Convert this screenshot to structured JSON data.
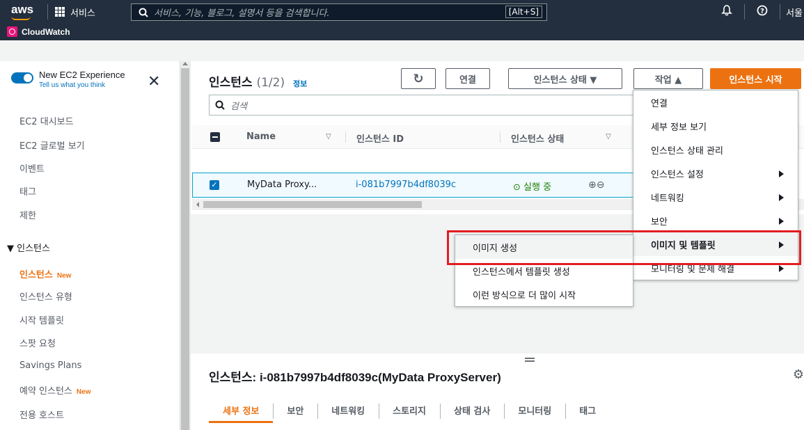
{
  "topnav": {
    "logo": "aws",
    "services_label": "서비스",
    "search_placeholder": "서비스, 기능, 블로그, 설명서 등을 검색합니다.",
    "search_shortcut": "[Alt+S]",
    "region": "서울",
    "favorite_service": "CloudWatch"
  },
  "sidebar": {
    "new_experience_title": "New EC2 Experience",
    "new_experience_sub": "Tell us what you think",
    "items": [
      {
        "label": "EC2 대시보드"
      },
      {
        "label": "EC2 글로벌 보기"
      },
      {
        "label": "이벤트"
      },
      {
        "label": "태그"
      },
      {
        "label": "제한"
      }
    ],
    "section_instances": "▼ 인스턴스",
    "instance_items": [
      {
        "label": "인스턴스",
        "badge": "New"
      },
      {
        "label": "인스턴스 유형"
      },
      {
        "label": "시작 템플릿"
      },
      {
        "label": "스팟 요청"
      },
      {
        "label": "Savings Plans"
      },
      {
        "label": "예약 인스턴스",
        "badge": "New"
      },
      {
        "label": "전용 호스트"
      }
    ]
  },
  "list": {
    "title": "인스턴스",
    "count": "(1/2)",
    "info": "정보",
    "buttons": {
      "refresh": "↻",
      "connect": "연결",
      "instance_state": "인스턴스 상태 ▼",
      "actions": "작업 ▲",
      "launch": "인스턴스 시작"
    },
    "search_placeholder": "검색",
    "columns": [
      "Name",
      "인스턴스 ID",
      "인스턴스 상태"
    ],
    "rows": [
      {
        "name": "MyData Proxy...",
        "id": "i-081b7997b4df8039c",
        "state": "실행 중"
      }
    ]
  },
  "actions_menu": {
    "items": [
      {
        "label": "연결"
      },
      {
        "label": "세부 정보 보기"
      },
      {
        "label": "인스턴스 상태 관리"
      },
      {
        "label": "인스턴스 설정"
      },
      {
        "label": "네트워킹"
      },
      {
        "label": "보안"
      },
      {
        "label": "이미지 및 템플릿"
      },
      {
        "label": "모니터링 및 문제 해결"
      }
    ]
  },
  "submenu": {
    "items": [
      {
        "label": "이미지 생성"
      },
      {
        "label": "인스턴스에서 템플릿 생성"
      },
      {
        "label": "이런 방식으로 더 많이 시작"
      }
    ]
  },
  "detail": {
    "title": "인스턴스: i-081b7997b4df8039c(MyData ProxyServer)",
    "tabs": [
      "세부 정보",
      "보안",
      "네트워킹",
      "스토리지",
      "상태 검사",
      "모니터링",
      "태그"
    ]
  },
  "colors": {
    "nav_bg": "#232f3e",
    "accent_orange": "#ec7211",
    "link_blue": "#0073bb",
    "highlight_red": "#e21d23"
  }
}
